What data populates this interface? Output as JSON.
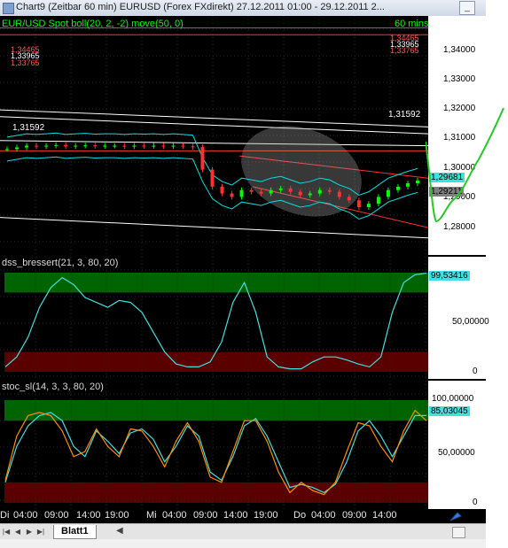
{
  "window": {
    "title": "Chart9 (Zeitbar 60 min)  EURUSD (Forex FXdirekt) 27.12.2011 01:00 - 29.12.2011 2..."
  },
  "price_panel": {
    "caption": "EUR/USD Spot  boll(20, 2, -2) move(50, 0)",
    "interval": "60 mins",
    "ticks": [
      "1,34000",
      "1,33000",
      "1,32000",
      "1,31000",
      "1,30000",
      "1,29000",
      "1,28000"
    ],
    "last_price": "1,29681",
    "last_price_2": "1,29211",
    "line_label_left": "1,31592",
    "line_label_right": "1,31592",
    "red_labels_left": [
      "1,34465",
      "1,33965",
      "1,33765"
    ],
    "red_labels_right": [
      "1,34465",
      "1,33965",
      "1,33765"
    ],
    "colors": {
      "up": "#00ff00",
      "down": "#ff3030",
      "boll": "#00e0e0",
      "lines": "#ffffff"
    }
  },
  "dss_panel": {
    "caption": "dss_bressert(21, 3, 80, 20)",
    "current": "99,53416",
    "ticks": [
      "50,00000",
      "0"
    ],
    "zones": {
      "upper": "#006400",
      "lower": "#5a0000"
    },
    "series_color": "#40e0e0"
  },
  "stoc_panel": {
    "caption": "stoc_sl(14, 3, 3, 80, 20)",
    "current": "85,03045",
    "ticks": [
      "100,00000",
      "50,00000",
      "0"
    ],
    "series_colors": [
      "#40e0e0",
      "#ff8c00"
    ]
  },
  "time_axis": {
    "labels": [
      "Di",
      "04:00",
      "09:00",
      "14:00",
      "19:00",
      "Mi",
      "04:00",
      "09:00",
      "14:00",
      "19:00",
      "Do",
      "04:00",
      "09:00",
      "14:00"
    ]
  },
  "bottom_bar": {
    "sheet_tab": "Blatt1",
    "nav_icons": [
      "first-icon",
      "prev-icon",
      "next-icon",
      "last-icon"
    ]
  },
  "chart_data": [
    {
      "type": "line",
      "title": "EUR/USD Spot",
      "ylim": [
        1.275,
        1.345
      ],
      "series": [
        {
          "name": "EUR/USD Spot",
          "values": [
            1.306,
            1.3065,
            1.307,
            1.3068,
            1.307,
            1.3072,
            1.3068,
            1.307,
            1.3071,
            1.3069,
            1.307,
            1.307,
            1.3068,
            1.307,
            1.3069,
            1.307,
            1.3068,
            1.307,
            1.3068,
            1.3066,
            1.3,
            1.295,
            1.293,
            1.292,
            1.294,
            1.2935,
            1.293,
            1.294,
            1.2945,
            1.2935,
            1.2925,
            1.293,
            1.294,
            1.2935,
            1.292,
            1.291,
            1.289,
            1.29,
            1.292,
            1.294,
            1.295,
            1.296,
            1.2968
          ]
        }
      ]
    },
    {
      "type": "line",
      "title": "dss_bressert(21, 3, 80, 20)",
      "ylim": [
        0,
        100
      ],
      "series": [
        {
          "name": "dss_bressert",
          "values": [
            5,
            15,
            35,
            65,
            85,
            95,
            88,
            75,
            70,
            65,
            72,
            70,
            60,
            40,
            20,
            8,
            5,
            5,
            10,
            30,
            70,
            90,
            60,
            15,
            5,
            3,
            3,
            10,
            15,
            15,
            12,
            8,
            5,
            15,
            60,
            90,
            98,
            99.5
          ]
        }
      ]
    },
    {
      "type": "line",
      "title": "stoc_sl(14, 3, 3, 80, 20)",
      "ylim": [
        0,
        100
      ],
      "series": [
        {
          "values": [
            20,
            55,
            75,
            85,
            88,
            80,
            55,
            45,
            70,
            60,
            48,
            68,
            72,
            62,
            40,
            55,
            75,
            65,
            30,
            22,
            45,
            75,
            82,
            65,
            40,
            15,
            18,
            15,
            10,
            18,
            40,
            70,
            80,
            65,
            45,
            65,
            85,
            85
          ]
        },
        {
          "values": [
            22,
            65,
            85,
            88,
            85,
            70,
            45,
            50,
            72,
            55,
            45,
            72,
            70,
            55,
            35,
            60,
            78,
            60,
            25,
            20,
            50,
            80,
            80,
            60,
            30,
            10,
            20,
            12,
            8,
            20,
            50,
            78,
            75,
            55,
            40,
            70,
            90,
            80
          ]
        }
      ]
    }
  ]
}
